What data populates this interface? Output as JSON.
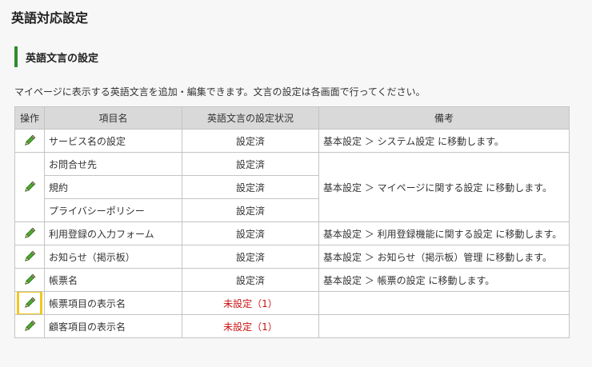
{
  "page": {
    "title": "英語対応設定"
  },
  "section": {
    "title": "英語文言の設定"
  },
  "description": "マイページに表示する英語文言を追加・編集できます。文言の設定は各画面で行ってください。",
  "table": {
    "headers": [
      "操作",
      "項目名",
      "英語文言の設定状況",
      "備考"
    ],
    "rows": [
      {
        "name": "サービス名の設定",
        "status": "設定済",
        "note": "基本設定 ＞ システム設定 に移動します。"
      },
      {
        "name": "お問合せ先",
        "status": "設定済",
        "note": "基本設定 ＞ マイページに関する設定 に移動します。"
      },
      {
        "name": "規約",
        "status": "設定済"
      },
      {
        "name": "プライバシーポリシー",
        "status": "設定済"
      },
      {
        "name": "利用登録の入力フォーム",
        "status": "設定済",
        "note": "基本設定 ＞ 利用登録機能に関する設定 に移動します。"
      },
      {
        "name": "お知らせ（掲示板）",
        "status": "設定済",
        "note": "基本設定 ＞ お知らせ（掲示板）管理 に移動します。"
      },
      {
        "name": "帳票名",
        "status": "設定済",
        "note": "基本設定 ＞ 帳票の設定 に移動します。"
      },
      {
        "name": "帳票項目の表示名",
        "status": "未設定（1）",
        "note": ""
      },
      {
        "name": "顧客項目の表示名",
        "status": "未設定（1）",
        "note": ""
      }
    ]
  },
  "icons": {
    "edit": "pencil-icon"
  },
  "colors": {
    "accent_bar": "#2e8b2e",
    "unset_status": "#cc1111",
    "highlight": "#f3c623",
    "header_bg": "#d9d9d9"
  }
}
